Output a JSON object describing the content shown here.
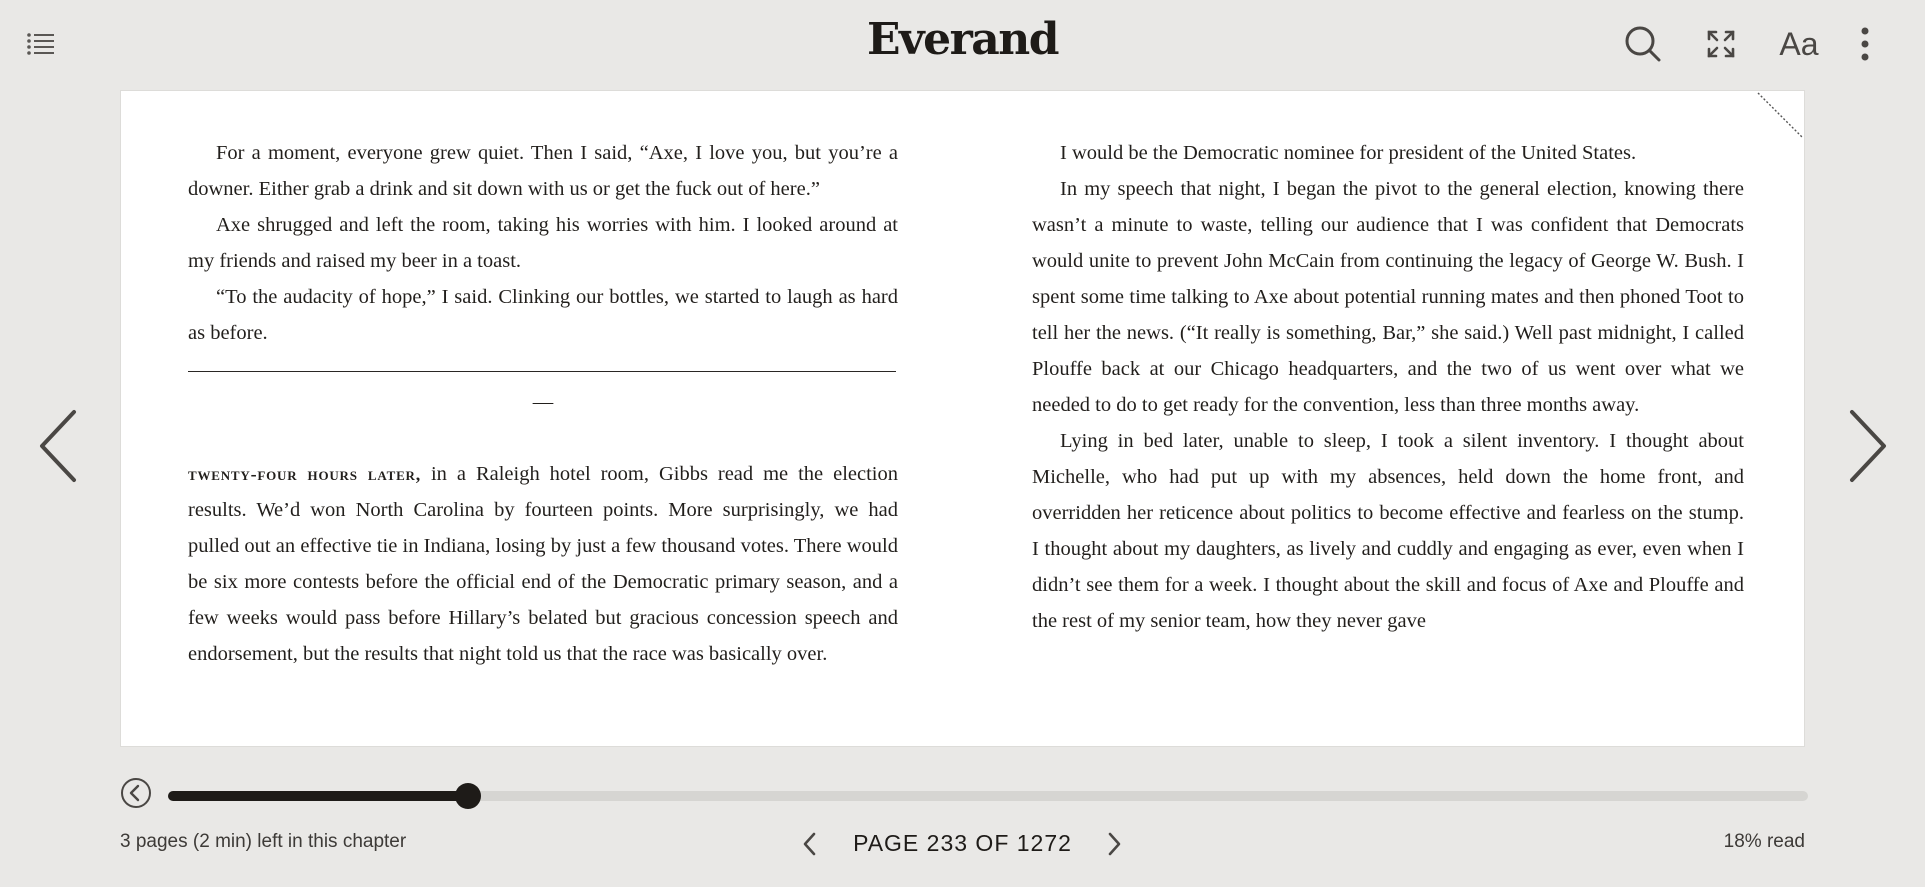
{
  "header": {
    "brand": "Everand",
    "font_button_label": "Aa",
    "icons": [
      "list-icon",
      "search-icon",
      "fullscreen-icon",
      "more-vertical-icon"
    ]
  },
  "reader": {
    "left_column": {
      "paragraphs": [
        "For a moment, everyone grew quiet. Then I said, “Axe, I love you, but you’re a downer. Either grab a drink and sit down with us or get the fuck out of here.”",
        "Axe shrugged and left the room, taking his worries with him. I looked around at my friends and raised my beer in a toast.",
        "“To the audacity of hope,” I said. Clinking our bottles, we started to laugh as hard as before."
      ],
      "section_break": "—",
      "section_lead_in": "twenty-four hours later,",
      "section_paragraph": " in a Raleigh hotel room, Gibbs read me the election results. We’d won North Carolina by fourteen points. More surprisingly, we had pulled out an effective tie in Indiana, losing by just a few thousand votes. There would be six more contests before the official end of the Democratic primary season, and a few weeks would pass before Hillary’s belated but gracious concession speech and endorsement, but the results that night told us that the race was basically over."
    },
    "right_column": {
      "continued": "I would be the Democratic nominee for president of the United States.",
      "paragraphs": [
        "In my speech that night, I began the pivot to the general election, knowing there wasn’t a minute to waste, telling our audience that I was confident that Democrats would unite to prevent John McCain from continuing the legacy of George W. Bush. I spent some time talking to Axe about potential running mates and then phoned Toot to tell her the news. (“It really is something, Bar,” she said.) Well past midnight, I called Plouffe back at our Chicago headquarters, and the two of us went over what we needed to do to get ready for the convention, less than three months away.",
        "Lying in bed later, unable to sleep, I took a silent inventory. I thought about Michelle, who had put up with my absences, held down the home front, and overridden her reticence about politics to become effective and fearless on the stump. I thought about my daughters, as lively and cuddly and engaging as ever, even when I didn’t see them for a week. I thought about the skill and focus of Axe and Plouffe and the rest of my senior team, how they never gave"
      ]
    },
    "icons": [
      "chevron-left-icon",
      "chevron-right-icon",
      "dog-ear-bookmark-icon"
    ]
  },
  "footer": {
    "chapter_remaining": "3 pages (2 min) left in this chapter",
    "page_label": "PAGE 233 OF 1272",
    "percent_read": "18% read",
    "progress_fraction": 0.183,
    "icons": [
      "back-circle-icon",
      "chevron-left-icon",
      "chevron-right-icon"
    ]
  },
  "colors": {
    "background": "#e9e8e6",
    "page": "#ffffff",
    "ink": "#1e1b18",
    "track": "#d6d5d2"
  }
}
